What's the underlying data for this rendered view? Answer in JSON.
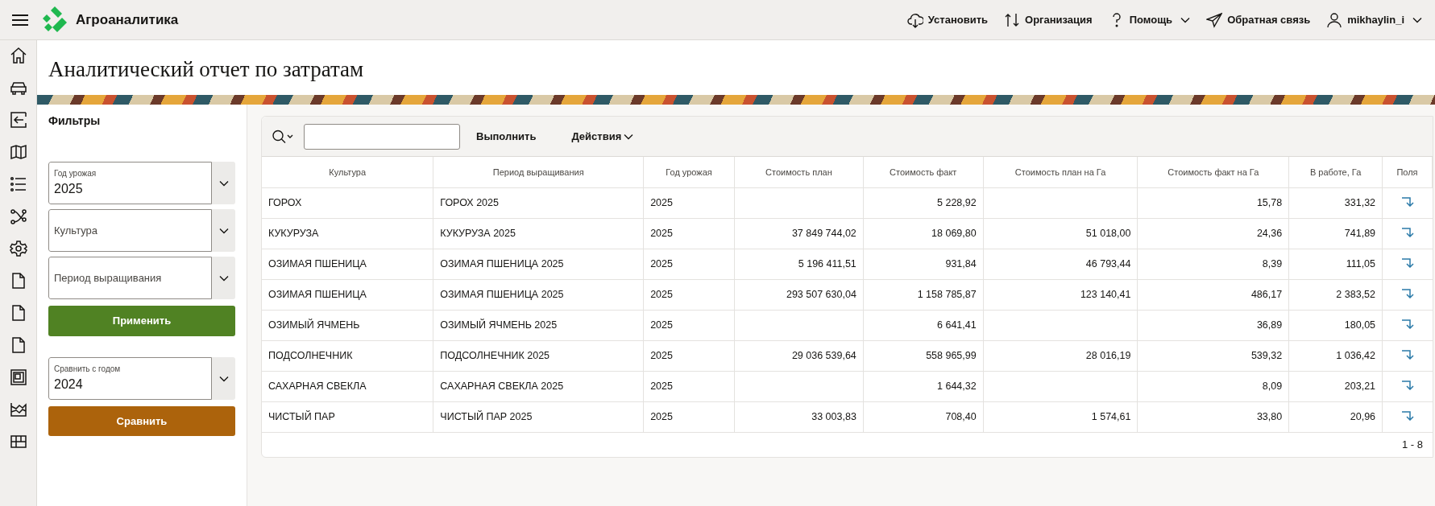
{
  "topbar": {
    "app_name": "Агроаналитика",
    "nav": [
      {
        "label": "Установить",
        "kind": "install",
        "has_menu": false
      },
      {
        "label": "Организация",
        "kind": "org",
        "has_menu": false
      },
      {
        "label": "Помощь",
        "kind": "help",
        "has_menu": true
      },
      {
        "label": "Обратная связь",
        "kind": "feedback",
        "has_menu": false
      },
      {
        "label": "mikhaylin_i",
        "kind": "user",
        "has_menu": true
      }
    ]
  },
  "page": {
    "title": "Аналитический отчет по затратам"
  },
  "filters": {
    "title": "Фильтры",
    "selects": [
      {
        "label": "Год урожая",
        "value": "2025"
      },
      {
        "label": "Культура"
      },
      {
        "label": "Период выращивания"
      }
    ],
    "apply_button": "Применить",
    "compare_select": {
      "label": "Сравнить с годом",
      "value": "2024"
    },
    "compare_button": "Сравнить"
  },
  "report": {
    "toolbar": {
      "go_button": "Выполнить",
      "actions_menu": "Действия"
    },
    "columns": [
      {
        "label": "Культура",
        "kind": "text"
      },
      {
        "label": "Период выращивания",
        "kind": "text"
      },
      {
        "label": "Год урожая",
        "kind": "text"
      },
      {
        "label": "Стоимость план",
        "kind": "number"
      },
      {
        "label": "Стоимость факт",
        "kind": "number"
      },
      {
        "label": "Стоимость план на Га",
        "kind": "number"
      },
      {
        "label": "Стоимость факт на Га",
        "kind": "number"
      },
      {
        "label": "В работе, Га",
        "kind": "number"
      },
      {
        "label": "Поля",
        "kind": "link"
      }
    ],
    "rows": [
      {
        "cells": [
          "ГОРОХ",
          "ГОРОХ 2025",
          "2025",
          null,
          "5 228,92",
          null,
          "15,78",
          "331,32",
          null
        ]
      },
      {
        "cells": [
          "КУКУРУЗА",
          "КУКУРУЗА 2025",
          "2025",
          "37 849 744,02",
          "18 069,80",
          "51 018,00",
          "24,36",
          "741,89",
          null
        ]
      },
      {
        "cells": [
          "ОЗИМАЯ ПШЕНИЦА",
          "ОЗИМАЯ ПШЕНИЦА 2025",
          "2025",
          "5 196 411,51",
          "931,84",
          "46 793,44",
          "8,39",
          "111,05",
          null
        ]
      },
      {
        "cells": [
          "ОЗИМАЯ ПШЕНИЦА",
          "ОЗИМАЯ ПШЕНИЦА 2025",
          "2025",
          "293 507 630,04",
          "1 158 785,87",
          "123 140,41",
          "486,17",
          "2 383,52",
          null
        ]
      },
      {
        "cells": [
          "ОЗИМЫЙ ЯЧМЕНЬ",
          "ОЗИМЫЙ ЯЧМЕНЬ 2025",
          "2025",
          null,
          "6 641,41",
          null,
          "36,89",
          "180,05",
          null
        ]
      },
      {
        "cells": [
          "ПОДСОЛНЕЧНИК",
          "ПОДСОЛНЕЧНИК 2025",
          "2025",
          "29 036 539,64",
          "558 965,99",
          "28 016,19",
          "539,32",
          "1 036,42",
          null
        ]
      },
      {
        "cells": [
          "САХАРНАЯ СВЕКЛА",
          "САХАРНАЯ СВЕКЛА 2025",
          "2025",
          null,
          "1 644,32",
          null,
          "8,09",
          "203,21",
          null
        ]
      },
      {
        "cells": [
          "ЧИСТЫЙ ПАР",
          "ЧИСТЫЙ ПАР 2025",
          "2025",
          "33 003,83",
          "708,40",
          "1 574,61",
          "33,80",
          "20,96",
          null
        ]
      }
    ],
    "pagination": "1 - 8"
  }
}
